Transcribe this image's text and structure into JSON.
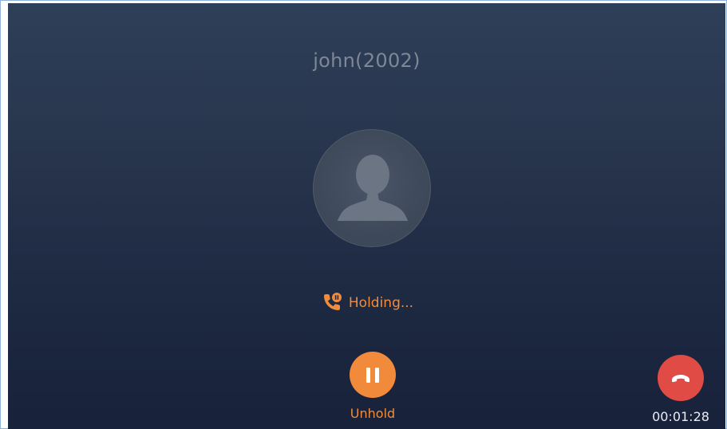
{
  "call": {
    "caller_name": "john(2002)",
    "status_text": "Holding...",
    "status_icon": "phone-hold-icon",
    "avatar_icon": "person-silhouette-icon"
  },
  "controls": {
    "unhold_label": "Unhold",
    "unhold_icon": "pause-icon",
    "end_call_icon": "hang-up-icon",
    "call_duration": "00:01:28"
  },
  "colors": {
    "accent_orange": "#f28a3c",
    "end_call_red": "#e14b45",
    "background_top": "#2f3f58",
    "background_bottom": "#18223a",
    "caller_name_text": "#7e8796",
    "timer_text": "#e8ecf2"
  }
}
